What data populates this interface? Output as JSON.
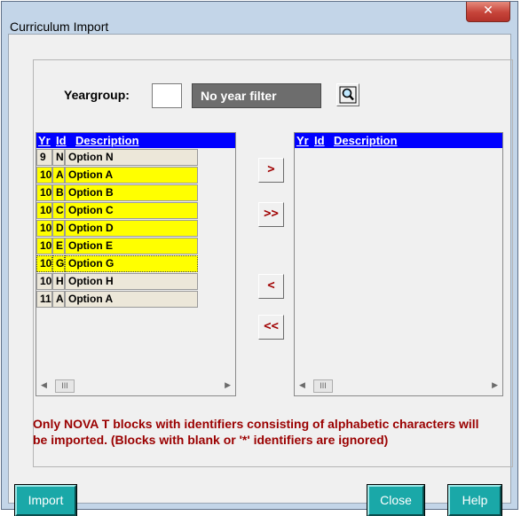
{
  "window": {
    "title": "Curriculum Import",
    "close_glyph": "✕"
  },
  "yeargroup": {
    "label": "Yeargroup:",
    "value": "",
    "filter_text": "No year filter",
    "search_icon": "magnifier-icon"
  },
  "left_list": {
    "headers": {
      "yr": "Yr",
      "id": "Id",
      "description": "Description"
    },
    "rows": [
      {
        "yr": "9",
        "id": "N",
        "description": "Option N",
        "selected": false
      },
      {
        "yr": "10",
        "id": "A",
        "description": "Option A",
        "selected": true
      },
      {
        "yr": "10",
        "id": "B",
        "description": "Option B",
        "selected": true
      },
      {
        "yr": "10",
        "id": "C",
        "description": "Option C",
        "selected": true
      },
      {
        "yr": "10",
        "id": "D",
        "description": "Option D",
        "selected": true
      },
      {
        "yr": "10",
        "id": "E",
        "description": "Option E",
        "selected": true
      },
      {
        "yr": "10",
        "id": "G",
        "description": "Option G",
        "selected": true
      },
      {
        "yr": "10",
        "id": "H",
        "description": "Option H",
        "selected": false
      },
      {
        "yr": "11",
        "id": "A",
        "description": "Option A",
        "selected": false
      }
    ],
    "scroll_thumb": "III"
  },
  "right_list": {
    "headers": {
      "yr": "Yr",
      "id": "Id",
      "description": "Description"
    },
    "rows": [],
    "scroll_thumb": "III"
  },
  "move_buttons": {
    "add_one": ">",
    "add_all": ">>",
    "remove_one": "<",
    "remove_all": "<<"
  },
  "note": "Only NOVA T blocks with identifiers consisting of alphabetic characters will be imported. (Blocks with blank or '*' identifiers are ignored)",
  "buttons": {
    "import": "Import",
    "close": "Close",
    "help": "Help"
  },
  "colors": {
    "list_header": "#0000ff",
    "selected_row": "#ffff00",
    "note_text": "#9a0000",
    "action_button": "#1aa8a8",
    "filter_box": "#6d6d6d"
  }
}
